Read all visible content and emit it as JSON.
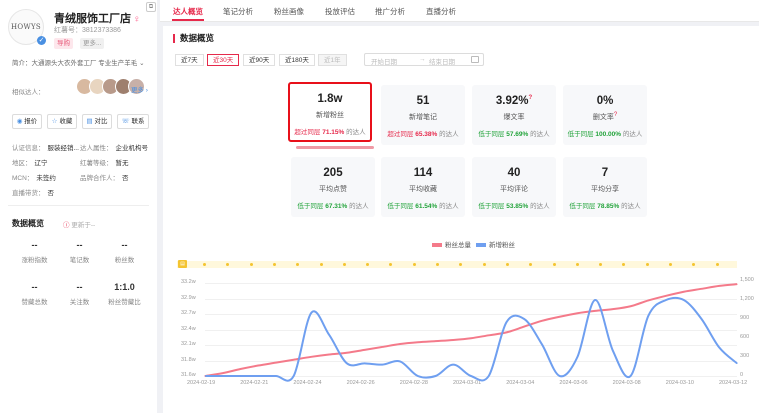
{
  "profile": {
    "logo_text": "HOWYS",
    "name": "青绒服饰工厂店",
    "red_id": "红薯号：3812373386",
    "tags": [
      "导购",
      "更多..."
    ],
    "intro": "简介：大通源头大衣外套工厂 专业生产羊毛",
    "collab_label": "相似达人：",
    "collab_more": "更多",
    "actions": [
      "报价",
      "收藏",
      "对比",
      "联系"
    ],
    "fields": [
      {
        "k": "认证信息：",
        "v": "服装经销..."
      },
      {
        "k": "达人属性：",
        "v": "企业机构号"
      },
      {
        "k": "地区：",
        "v": "辽宁"
      },
      {
        "k": "红薯等级：",
        "v": "暂无"
      },
      {
        "k": "MCN：",
        "v": "未签约"
      },
      {
        "k": "品牌合作人：",
        "v": "否"
      },
      {
        "k": "直播带货：",
        "v": "否"
      }
    ]
  },
  "overview": {
    "title": "数据概览",
    "subtitle": "更新于--",
    "stats": [
      {
        "v": "--",
        "l": "涨粉指数"
      },
      {
        "v": "--",
        "l": "笔记数"
      },
      {
        "v": "--",
        "l": "粉丝数"
      },
      {
        "v": "--",
        "l": "赞藏总数"
      },
      {
        "v": "--",
        "l": "关注数"
      },
      {
        "v": "1:1.0",
        "l": "粉丝赞藏比"
      }
    ]
  },
  "tabs": [
    "达人概览",
    "笔记分析",
    "粉丝画像",
    "投放评估",
    "推广分析",
    "直播分析"
  ],
  "panel_title": "数据概览",
  "ranges": [
    "近7天",
    "近30天",
    "近90天",
    "近180天",
    "近1年"
  ],
  "date_start": "开始日期",
  "date_sep": "→",
  "date_end": "结束日期",
  "cards": [
    {
      "value": "1.8w",
      "label": "新增粉丝",
      "cmp": "超过同层",
      "pct": "71.15%",
      "suffix": "的达人",
      "color": "#e6294b"
    },
    {
      "value": "51",
      "label": "新增笔记",
      "cmp": "超过同层",
      "pct": "65.38%",
      "suffix": "的达人",
      "color": "#e6294b"
    },
    {
      "value": "3.92%",
      "label": "爆文率",
      "cmp": "低于同层",
      "pct": "57.69%",
      "suffix": "的达人",
      "color": "#22a33a"
    },
    {
      "value": "0%",
      "label": "删文率",
      "cmp": "低于同层",
      "pct": "100.00%",
      "suffix": "的达人",
      "color": "#22a33a"
    },
    {
      "value": "205",
      "label": "平均点赞",
      "cmp": "低于同层",
      "pct": "67.31%",
      "suffix": "的达人",
      "color": "#22a33a"
    },
    {
      "value": "114",
      "label": "平均收藏",
      "cmp": "低于同层",
      "pct": "61.54%",
      "suffix": "的达人",
      "color": "#22a33a"
    },
    {
      "value": "40",
      "label": "平均评论",
      "cmp": "低于同层",
      "pct": "53.85%",
      "suffix": "的达人",
      "color": "#22a33a"
    },
    {
      "value": "7",
      "label": "平均分享",
      "cmp": "低于同层",
      "pct": "78.85%",
      "suffix": "的达人",
      "color": "#22a33a"
    }
  ],
  "chart_data": {
    "type": "line",
    "series": [
      {
        "name": "粉丝总量",
        "color": "#f47a8a",
        "axis": "left"
      },
      {
        "name": "新增粉丝",
        "color": "#6f9ff0",
        "axis": "right"
      }
    ],
    "strip_label": "笔记",
    "y_left_ticks": [
      "33.2w",
      "32.9w",
      "32.7w",
      "32.4w",
      "32.1w",
      "31.8w",
      "31.6w"
    ],
    "y_right_ticks": [
      "1,500",
      "1,200",
      "900",
      "600",
      "300",
      "0"
    ],
    "x_ticks": [
      "2024-02-19",
      "2024-02-21",
      "2024-02-24",
      "2024-02-26",
      "2024-02-28",
      "2024-03-01",
      "2024-03-04",
      "2024-03-06",
      "2024-03-08",
      "2024-03-10",
      "2024-03-12"
    ],
    "fans_total_w": [
      31.6,
      31.65,
      31.72,
      31.78,
      31.83,
      31.88,
      31.93,
      31.97,
      32.0,
      32.05,
      32.1,
      32.15,
      32.18,
      32.2,
      32.22,
      32.25,
      32.3,
      32.35,
      32.45,
      32.55,
      32.62,
      32.68,
      32.72,
      32.75,
      32.8,
      32.9,
      32.98,
      33.05,
      33.1,
      33.15,
      33.18
    ],
    "fans_new": [
      0,
      0,
      0,
      0,
      0,
      0,
      1000,
      650,
      200,
      200,
      180,
      230,
      0,
      0,
      180,
      0,
      0,
      850,
      900,
      500,
      0,
      300,
      1200,
      400,
      0,
      950,
      1200,
      1200,
      900,
      450,
      200
    ]
  }
}
